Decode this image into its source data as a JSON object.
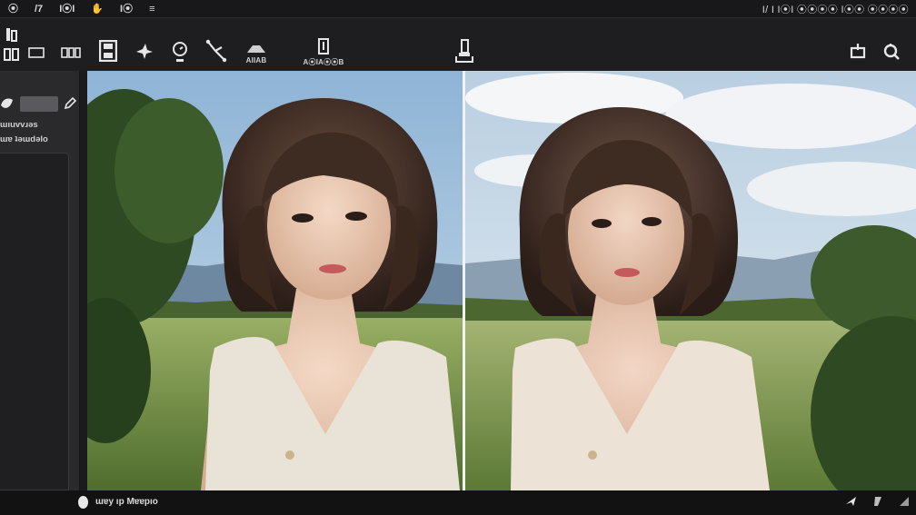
{
  "menubar": {
    "items": [
      "⦿",
      "/7",
      "I⦿I",
      "✋",
      "I⦿",
      "≡"
    ],
    "right_text": "I/ I I⦿I ⦿⦿⦿⦿ I⦿⦿ ⦿⦿⦿⦿"
  },
  "toolbar": {
    "tools": [
      {
        "name": "layers-tool",
        "icon": "layers-icon"
      },
      {
        "name": "frame-tool",
        "icon": "frame-icon"
      },
      {
        "name": "panels-tool",
        "icon": "panels-icon"
      },
      {
        "name": "save-tool",
        "icon": "save-icon"
      },
      {
        "name": "brush-tool",
        "icon": "brush-icon"
      },
      {
        "name": "history-tool",
        "icon": "history-icon"
      },
      {
        "name": "transform-tool",
        "icon": "transform-icon"
      },
      {
        "name": "shape-tool",
        "icon": "shape-icon",
        "label": "AIIAB"
      },
      {
        "name": "export-tool",
        "icon": "export-icon",
        "label": "A⦿IA⦿⦿B"
      },
      {
        "name": "compare-tool",
        "icon": "compare-icon"
      },
      {
        "name": "share-tool",
        "icon": "share-icon"
      },
      {
        "name": "zoom-tool",
        "icon": "search-icon"
      }
    ]
  },
  "left_panel": {
    "line1": "ɯıuvvɹǝs",
    "line2": "ɯɐ ʇǝɯdǝlo"
  },
  "canvas": {
    "left_view": "original",
    "right_view": "processed",
    "colors": {
      "sky": "#9fbfdc",
      "grass": "#7c9a4c",
      "divider": "#f2f2f2"
    }
  },
  "statusbar": {
    "text": "ɯɐy ıp Mɐɐpıo"
  }
}
